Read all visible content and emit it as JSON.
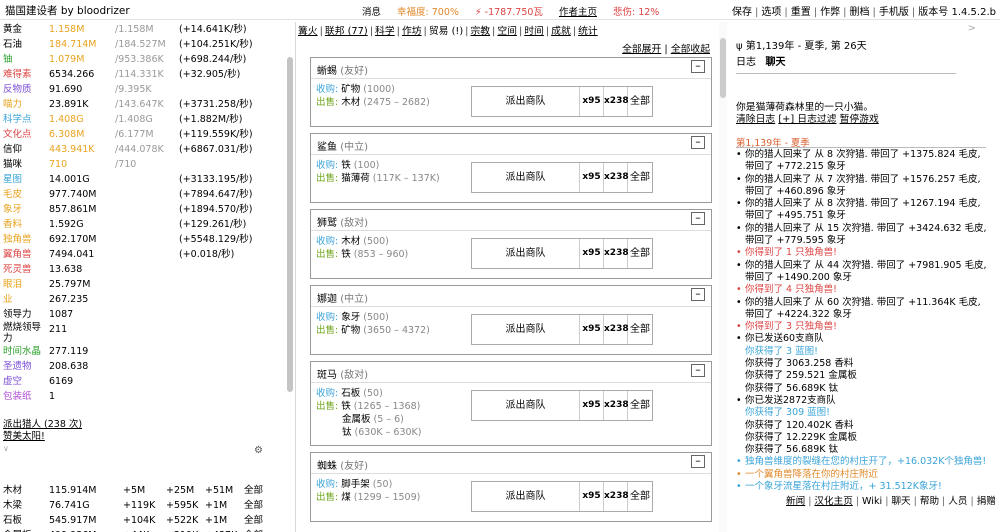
{
  "topbar": {
    "title": "猫国建设者 by bloodrizer",
    "messages": "消息",
    "happiness": "幸福度: 700%",
    "energy": "⚡  -1787.750瓦",
    "author": "作者主页",
    "sorrow": "悲伤: 12%",
    "menu": [
      "保存",
      "选项",
      "重置",
      "作弊",
      "删档",
      "手机版",
      "版本号 1.4.5.2.b"
    ],
    "colors": {
      "happiness": "#e0892b",
      "energy": "#d44",
      "sorrow": "#d44"
    }
  },
  "resources": [
    {
      "name": "黄金",
      "value": "1.158M",
      "max": "/1.158M",
      "rate": "(+14.641K/秒)",
      "name_color": "#000",
      "value_color": "#e9a31f"
    },
    {
      "name": "石油",
      "value": "184.714M",
      "max": "/184.527M",
      "rate": "(+104.251K/秒)",
      "name_color": "#000",
      "value_color": "#e9a31f"
    },
    {
      "name": "铀",
      "value": "1.079M",
      "max": "/953.386K",
      "rate": "(+698.244/秒)",
      "name_color": "#2a9d2a",
      "value_color": "#e9a31f"
    },
    {
      "name": "难得素",
      "value": "6534.266",
      "max": "/114.331K",
      "rate": "(+32.905/秒)",
      "name_color": "#d44",
      "value_color": "#000"
    },
    {
      "name": "反物质",
      "value": "91.690",
      "max": "/9.395K",
      "rate": "",
      "name_color": "#7a4fd6",
      "value_color": "#000"
    },
    {
      "name": "喵力",
      "value": "23.891K",
      "max": "/143.647K",
      "rate": "(+3731.258/秒)",
      "name_color": "#e9a31f",
      "value_color": "#000"
    },
    {
      "name": "科学点",
      "value": "1.408G",
      "max": "/1.408G",
      "rate": "(+1.882M/秒)",
      "name_color": "#3aa4d8",
      "value_color": "#e9a31f"
    },
    {
      "name": "文化点",
      "value": "6.308M",
      "max": "/6.177M",
      "rate": "(+119.559K/秒)",
      "name_color": "#d44",
      "value_color": "#e9a31f"
    },
    {
      "name": "信仰",
      "value": "443.941K",
      "max": "/444.078K",
      "rate": "(+6867.031/秒)",
      "name_color": "#000",
      "value_color": "#e9a31f"
    },
    {
      "name": "猫咪",
      "value": "710",
      "max": "/710",
      "rate": "",
      "name_color": "#000",
      "value_color": "#e9a31f"
    },
    {
      "name": "星图",
      "value": "14.001G",
      "max": "",
      "rate": "(+3133.195/秒)",
      "name_color": "#3aa4d8",
      "value_color": "#000"
    },
    {
      "name": "毛皮",
      "value": "977.740M",
      "max": "",
      "rate": "(+7894.647/秒)",
      "name_color": "#e9a31f",
      "value_color": "#000"
    },
    {
      "name": "象牙",
      "value": "857.861M",
      "max": "",
      "rate": "(+1894.570/秒)",
      "name_color": "#e9a31f",
      "value_color": "#000"
    },
    {
      "name": "香料",
      "value": "1.592G",
      "max": "",
      "rate": "(+129.261/秒)",
      "name_color": "#e9a31f",
      "value_color": "#000"
    },
    {
      "name": "独角兽",
      "value": "692.170M",
      "max": "",
      "rate": "(+5548.129/秒)",
      "name_color": "#e9a31f",
      "value_color": "#000"
    },
    {
      "name": "翼角兽",
      "value": "7494.041",
      "max": "",
      "rate": "(+0.018/秒)",
      "name_color": "#d44",
      "value_color": "#000"
    },
    {
      "name": "死灵兽",
      "value": "13.638",
      "max": "",
      "rate": "",
      "name_color": "#d44",
      "value_color": "#000"
    },
    {
      "name": "眼泪",
      "value": "25.797M",
      "max": "",
      "rate": "",
      "name_color": "#e9a31f",
      "value_color": "#000"
    },
    {
      "name": "业",
      "value": "267.235",
      "max": "",
      "rate": "",
      "name_color": "#e9a31f",
      "value_color": "#000"
    },
    {
      "name": "领导力",
      "value": "1087",
      "max": "",
      "rate": "",
      "name_color": "#000",
      "value_color": "#000"
    },
    {
      "name": "燃烧领导力",
      "value": "211",
      "max": "",
      "rate": "",
      "name_color": "#000",
      "value_color": "#000",
      "tall": true
    },
    {
      "name": "时间水晶",
      "value": "277.119",
      "max": "",
      "rate": "",
      "name_color": "#2a9d2a",
      "value_color": "#000"
    },
    {
      "name": "圣遗物",
      "value": "208.638",
      "max": "",
      "rate": "",
      "name_color": "#7a4fd6",
      "value_color": "#000"
    },
    {
      "name": "虚空",
      "value": "6169",
      "max": "",
      "rate": "",
      "name_color": "#7a4fd6",
      "value_color": "#000"
    },
    {
      "name": "包装纸",
      "value": "1",
      "max": "",
      "rate": "",
      "name_color": "#b04fd6",
      "value_color": "#000"
    }
  ],
  "hunt": {
    "send": "派出猎人 (238 次)",
    "praise": "赞美太阳!"
  },
  "craft": [
    {
      "name": "木材",
      "value": "115.914M",
      "a": "+5M",
      "b": "+25M",
      "c": "+51M",
      "all": "全部"
    },
    {
      "name": "木梁",
      "value": "76.741G",
      "a": "+119K",
      "b": "+595K",
      "c": "+1M",
      "all": "全部"
    },
    {
      "name": "石板",
      "value": "545.917M",
      "a": "+104K",
      "b": "+522K",
      "c": "+1M",
      "all": "全部"
    },
    {
      "name": "金属板",
      "value": "499.936M",
      "a": "+44K",
      "b": "+219K",
      "c": "+437K",
      "all": "全部"
    }
  ],
  "tabs": [
    "篝火",
    "联邦 (77)",
    "科学",
    "作坊",
    "贸易 (!)",
    "宗教",
    "空间",
    "时间",
    "成就",
    "统计"
  ],
  "expand": {
    "expand_all": "全部展开",
    "collapse_all": "全部收起"
  },
  "races": [
    {
      "name": "蜥蜴",
      "attitude": "(友好)",
      "buy_label": "收购:",
      "buy": "矿物",
      "buy_amt": "(1000)",
      "sell_label": "出售:",
      "sells": [
        {
          "item": "木材",
          "amt": "(2475 – 2682)"
        }
      ],
      "send": "派出商队",
      "x1": "x95",
      "x2": "x238",
      "all": "全部"
    },
    {
      "name": "鲨鱼",
      "attitude": "(中立)",
      "buy_label": "收购:",
      "buy": "铁",
      "buy_amt": "(100)",
      "sell_label": "出售:",
      "sells": [
        {
          "item": "猫薄荷",
          "amt": "(117K – 137K)"
        }
      ],
      "send": "派出商队",
      "x1": "x95",
      "x2": "x238",
      "all": "全部"
    },
    {
      "name": "狮鹫",
      "attitude": "(敌对)",
      "buy_label": "收购:",
      "buy": "木材",
      "buy_amt": "(500)",
      "sell_label": "出售:",
      "sells": [
        {
          "item": "铁",
          "amt": "(853 – 960)"
        }
      ],
      "send": "派出商队",
      "x1": "x95",
      "x2": "x238",
      "all": "全部"
    },
    {
      "name": "娜迦",
      "attitude": "(中立)",
      "buy_label": "收购:",
      "buy": "象牙",
      "buy_amt": "(500)",
      "sell_label": "出售:",
      "sells": [
        {
          "item": "矿物",
          "amt": "(3650 – 4372)"
        }
      ],
      "send": "派出商队",
      "x1": "x95",
      "x2": "x238",
      "all": "全部"
    },
    {
      "name": "斑马",
      "attitude": "(敌对)",
      "buy_label": "收购:",
      "buy": "石板",
      "buy_amt": "(50)",
      "sell_label": "出售:",
      "sells": [
        {
          "item": "铁",
          "amt": "(1265 – 1368)"
        },
        {
          "item": "金属板",
          "amt": "(5 – 6)"
        },
        {
          "item": "钛",
          "amt": "(630K – 630K)"
        }
      ],
      "send": "派出商队",
      "x1": "x95",
      "x2": "x238",
      "all": "全部"
    },
    {
      "name": "蜘蛛",
      "attitude": "(友好)",
      "buy_label": "收购:",
      "buy": "脚手架",
      "buy_amt": "(50)",
      "sell_label": "出售:",
      "sells": [
        {
          "item": "煤",
          "amt": "(1299 – 1509)"
        }
      ],
      "send": "派出商队",
      "x1": "x95",
      "x2": "x238",
      "all": "全部"
    }
  ],
  "right": {
    "carrot": ">",
    "date": "ψ 第1,139年 - 夏季, 第 26天",
    "tab_log": "日志",
    "tab_chat": "聊天",
    "info": "你是猫薄荷森林里的一只小猫。",
    "clear_log": "清除日志",
    "filter": "[+] 日志过滤",
    "pause": "暂停游戏",
    "season": "第1,139年 - 夏季",
    "log": [
      {
        "bullet": true,
        "text": "你的猎人回来了 从 8 次狩猎. 带回了 +1375.824 毛皮, 带回了 +772.215 象牙",
        "color": "#000"
      },
      {
        "bullet": true,
        "text": "你的猎人回来了 从 7 次狩猎. 带回了 +1576.257 毛皮, 带回了 +460.896 象牙",
        "color": "#000"
      },
      {
        "bullet": true,
        "text": "你的猎人回来了 从 8 次狩猎. 带回了 +1267.194 毛皮, 带回了 +495.751 象牙",
        "color": "#000"
      },
      {
        "bullet": true,
        "text": "你的猎人回来了 从 15 次狩猎. 带回了 +3424.632 毛皮, 带回了 +779.595 象牙",
        "color": "#000"
      },
      {
        "bullet": true,
        "text": "你得到了 1 只独角兽!",
        "color": "#d44"
      },
      {
        "bullet": true,
        "text": "你的猎人回来了 从 44 次狩猎. 带回了 +7981.905 毛皮, 带回了 +1490.200 象牙",
        "color": "#000"
      },
      {
        "bullet": true,
        "text": "你得到了 4 只独角兽!",
        "color": "#d44"
      },
      {
        "bullet": true,
        "text": "你的猎人回来了 从 60 次狩猎. 带回了 +11.364K 毛皮, 带回了 +4224.322 象牙",
        "color": "#000"
      },
      {
        "bullet": true,
        "text": "你得到了 3 只独角兽!",
        "color": "#d44"
      },
      {
        "bullet": true,
        "text": "你已发送60支商队",
        "color": "#000"
      },
      {
        "bullet": false,
        "text": "你获得了 3 蓝图!",
        "color": "#3aa4d8"
      },
      {
        "bullet": false,
        "text": "你获得了 3063.258 香料",
        "color": "#000"
      },
      {
        "bullet": false,
        "text": "你获得了 259.521 金属板",
        "color": "#000"
      },
      {
        "bullet": false,
        "text": "你获得了 56.689K 钛",
        "color": "#000"
      },
      {
        "bullet": true,
        "text": "你已发送2872支商队",
        "color": "#000"
      },
      {
        "bullet": false,
        "text": "你获得了 309 蓝图!",
        "color": "#3aa4d8"
      },
      {
        "bullet": false,
        "text": "你获得了 120.402K 香料",
        "color": "#000"
      },
      {
        "bullet": false,
        "text": "你获得了 12.229K 金属板",
        "color": "#000"
      },
      {
        "bullet": false,
        "text": "你获得了 56.689K 钛",
        "color": "#000"
      },
      {
        "bullet": true,
        "text": "独角兽维度的裂缝在您的村庄开了，+16.032K个独角兽!",
        "color": "#3aa4d8"
      },
      {
        "bullet": true,
        "text": "一个翼角兽降落在你的村庄附近",
        "color": "#e0892b"
      },
      {
        "bullet": true,
        "text": "一个象牙流星落在村庄附近，+ 31.512K象牙!",
        "color": "#3aa4d8"
      }
    ]
  },
  "footer": [
    "新闻",
    "汉化主页",
    "Wiki",
    "聊天",
    "帮助",
    "人员",
    "捐赠"
  ]
}
